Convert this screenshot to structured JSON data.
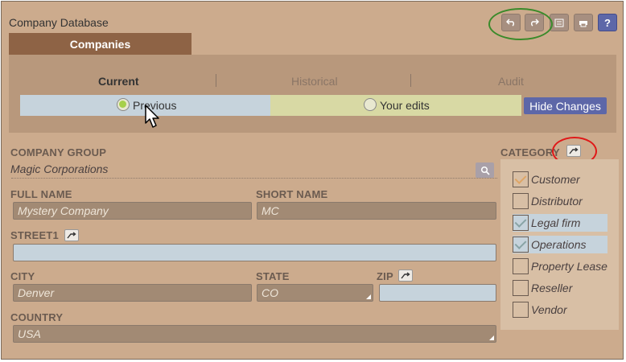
{
  "app": {
    "title": "Company Database"
  },
  "toolbar": {
    "buttons": [
      {
        "name": "undo",
        "icon": "undo-icon"
      },
      {
        "name": "redo",
        "icon": "redo-icon"
      },
      {
        "name": "list",
        "icon": "list-icon"
      },
      {
        "name": "print",
        "icon": "print-icon"
      },
      {
        "name": "help",
        "icon": "help-icon",
        "label": "?"
      }
    ]
  },
  "tabs": {
    "main": "Companies"
  },
  "history_tabs": [
    "Current",
    "Historical",
    "Audit"
  ],
  "compare": {
    "previous_label": "Previous",
    "edits_label": "Your edits",
    "hide_button": "Hide Changes"
  },
  "form": {
    "company_group": {
      "label": "COMPANY GROUP",
      "value": "Magic Corporations"
    },
    "full_name": {
      "label": "FULL NAME",
      "value": "Mystery Company"
    },
    "short_name": {
      "label": "SHORT NAME",
      "value": "MC"
    },
    "street1": {
      "label": "STREET1",
      "value": ""
    },
    "city": {
      "label": "CITY",
      "value": "Denver"
    },
    "state": {
      "label": "STATE",
      "value": "CO"
    },
    "zip": {
      "label": "ZIP",
      "value": ""
    },
    "country": {
      "label": "COUNTRY",
      "value": "USA"
    }
  },
  "category": {
    "label": "CATEGORY",
    "items": [
      {
        "label": "Customer",
        "checked": true,
        "highlighted": false
      },
      {
        "label": "Distributor",
        "checked": false,
        "highlighted": false
      },
      {
        "label": "Legal firm",
        "checked": true,
        "highlighted": true
      },
      {
        "label": "Operations",
        "checked": true,
        "highlighted": true
      },
      {
        "label": "Property Lease",
        "checked": false,
        "highlighted": false
      },
      {
        "label": "Reseller",
        "checked": false,
        "highlighted": false
      },
      {
        "label": "Vendor",
        "checked": false,
        "highlighted": false
      }
    ]
  },
  "colors": {
    "background": "#ccab8d",
    "accent": "#5d67a8",
    "tab": "#8e6345",
    "annotation_green": "#3a8a2a",
    "annotation_red": "#e01818"
  }
}
